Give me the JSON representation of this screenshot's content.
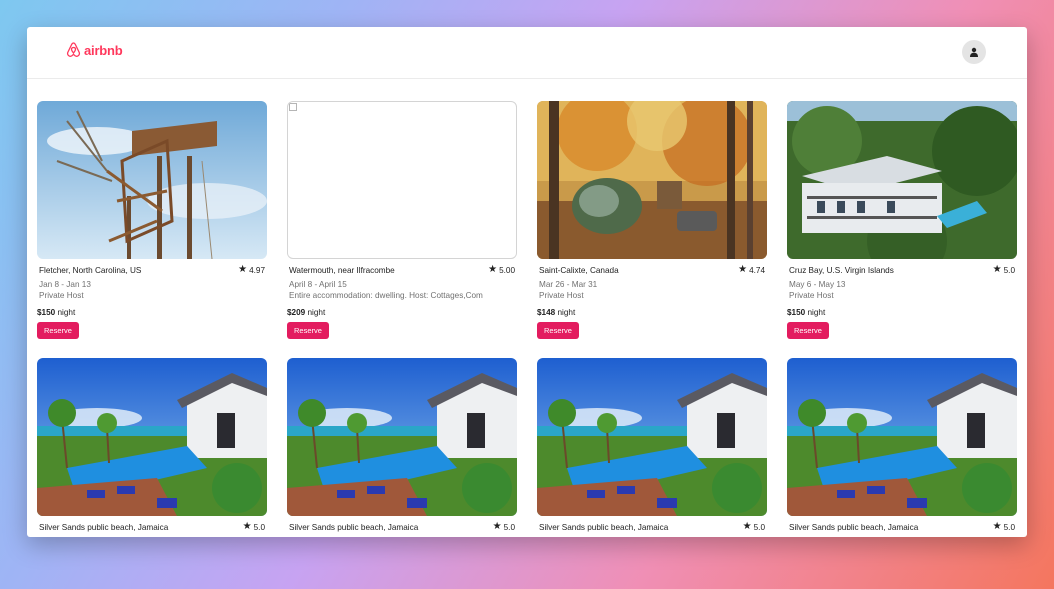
{
  "app": {
    "logo_text": "airbnb",
    "accent": "#ff385c"
  },
  "header": {
    "profile_icon": "user-icon"
  },
  "listings": [
    {
      "location": "Fletcher, North Carolina, US",
      "rating": "4.97",
      "dates": "Jan 8 - Jan 13",
      "host": "Private Host",
      "price": "$150",
      "price_suffix": "night",
      "reserve_label": "Reserve",
      "photo": "treehouse"
    },
    {
      "location": "Watermouth, near Ilfracombe",
      "rating": "5.00",
      "dates": "April 8 - April 15",
      "host": "Entire accommodation: dwelling. Host: Cottages,Com",
      "price": "$209",
      "price_suffix": "night",
      "reserve_label": "Reserve",
      "photo": "broken-image"
    },
    {
      "location": "Saint-Calixte, Canada",
      "rating": "4.74",
      "dates": "Mar 26 - Mar 31",
      "host": "Private Host",
      "price": "$148",
      "price_suffix": "night",
      "reserve_label": "Reserve",
      "photo": "bubble-tent-forest"
    },
    {
      "location": "Cruz Bay, U.S. Virgin Islands",
      "rating": "5.0",
      "dates": "May 6 - May 13",
      "host": "Private Host",
      "price": "$150",
      "price_suffix": "night",
      "reserve_label": "Reserve",
      "photo": "villa-hillside"
    },
    {
      "location": "Silver Sands public beach, Jamaica",
      "rating": "5.0",
      "photo": "pool-villa"
    },
    {
      "location": "Silver Sands public beach, Jamaica",
      "rating": "5.0",
      "photo": "pool-villa"
    },
    {
      "location": "Silver Sands public beach, Jamaica",
      "rating": "5.0",
      "photo": "pool-villa"
    },
    {
      "location": "Silver Sands public beach, Jamaica",
      "rating": "5.0",
      "photo": "pool-villa"
    }
  ]
}
